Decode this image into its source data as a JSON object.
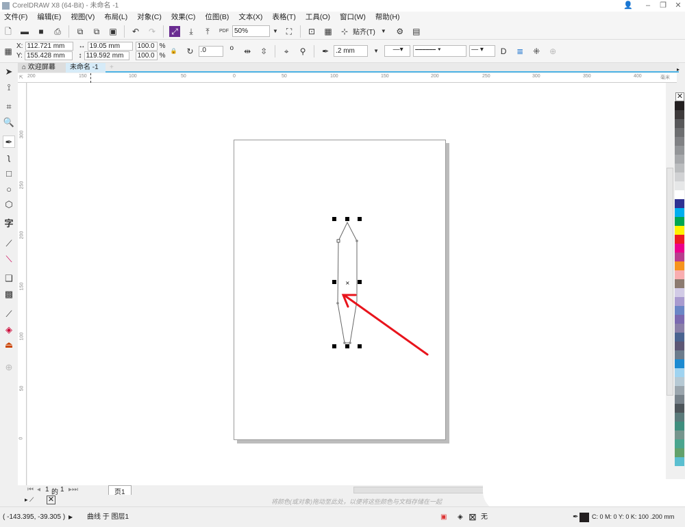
{
  "title": "CorelDRAW X8 (64-Bit) - 未命名 -1",
  "menu": [
    "文件(F)",
    "编辑(E)",
    "视图(V)",
    "布局(L)",
    "对象(C)",
    "效果(C)",
    "位图(B)",
    "文本(X)",
    "表格(T)",
    "工具(O)",
    "窗口(W)",
    "帮助(H)"
  ],
  "toolbar": {
    "zoom": "50%",
    "snap": "贴齐(T)",
    "pdf": "PDF"
  },
  "props": {
    "x_label": "X:",
    "x": "112.721 mm",
    "y_label": "Y:",
    "y": "155.428 mm",
    "w": "19.05 mm",
    "h": "119.592 mm",
    "sx": "100.0",
    "sy": "100.0",
    "pct": "%",
    "angle": ".0",
    "deg": "o",
    "outline": ".2 mm"
  },
  "tabs": {
    "welcome": "欢迎屏幕",
    "doc": "未命名 -1"
  },
  "hruler": [
    "200",
    "150",
    "100",
    "50",
    "0",
    "50",
    "100",
    "150",
    "200",
    "250",
    "300",
    "350",
    "400"
  ],
  "hruler_unit": "毫米",
  "vruler": [
    "300",
    "250",
    "200",
    "150",
    "100",
    "50",
    "0"
  ],
  "pager": {
    "current": "1",
    "of": "的",
    "total": "1",
    "page_tab": "页1"
  },
  "color_hint": "将颜色(或对象)拖动至此处，以便将这些颜色与文档存储在一起",
  "status": {
    "coords": "( -143.395, -39.305 )",
    "object": "曲线 于 图层1",
    "fill": "无",
    "outline": "C: 0 M: 0 Y: 0 K: 100  .200 mm"
  },
  "accent": "#4db3e6",
  "arrow_color": "#e8141c",
  "palette": [
    "#231f20",
    "#3d3a3b",
    "#58585a",
    "#6d6e70",
    "#808184",
    "#939598",
    "#a7a9ac",
    "#bbbdbf",
    "#d1d2d4",
    "#e6e7e8",
    "#ffffff",
    "#2e3192",
    "#00aeef",
    "#00a651",
    "#fff200",
    "#ed1c24",
    "#ec008c",
    "#b83d8e",
    "#f7941d",
    "#f9adb0",
    "#8c7b70",
    "#d2cbe6",
    "#a99bcf",
    "#6b86c6",
    "#7b69b0",
    "#8a7fa8",
    "#4a6390",
    "#5d5775",
    "#6b7b8c",
    "#1c8ad1",
    "#9fd3f0",
    "#b6c9d4",
    "#9aa5ad",
    "#77828a",
    "#4d555a",
    "#5a7a7a",
    "#3f8e7e",
    "#75958d",
    "#4aa58e",
    "#62a16b",
    "#5bbfd0"
  ]
}
